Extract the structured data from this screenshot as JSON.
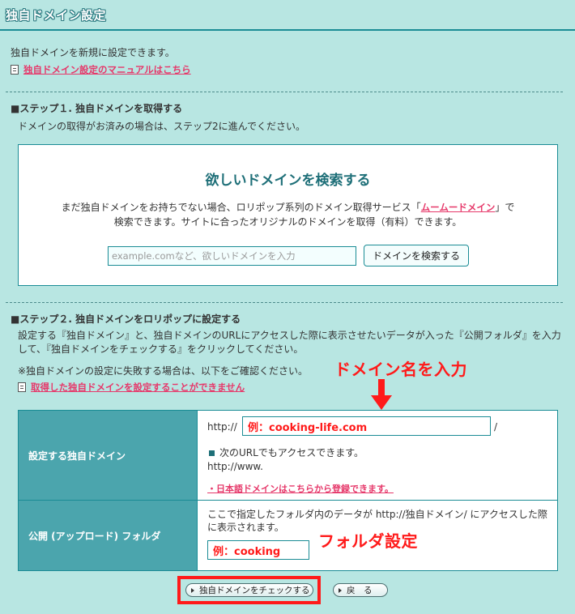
{
  "header": {
    "title": "独自ドメイン設定"
  },
  "intro": {
    "text": "独自ドメインを新規に設定できます。",
    "manual_link": "独自ドメイン設定のマニュアルはこちら"
  },
  "step1": {
    "heading": "■ステップ１. 独自ドメインを取得する",
    "desc": "ドメインの取得がお済みの場合は、ステップ2に進んでください。",
    "search": {
      "title": "欲しいドメインを検索する",
      "desc_line1_pre": "まだ独自ドメインをお持ちでない場合、ロリポップ系列のドメイン取得サービス「",
      "service_link": "ムームードメイン",
      "desc_line1_post": "」で",
      "desc_line2": "検索できます。サイトに合ったオリジナルのドメインを取得（有料）できます。",
      "placeholder": "example.comなど、欲しいドメインを入力",
      "button": "ドメインを検索する"
    }
  },
  "step2": {
    "heading": "■ステップ２. 独自ドメインをロリポップに設定する",
    "desc_line1": "設定する『独自ドメイン』と、独自ドメインのURLにアクセスした際に表示させたいデータが入った『公開フォルダ』を入力",
    "desc_line2": "して、『独自ドメインをチェックする』をクリックしてください。",
    "fail_note": "※独自ドメインの設定に失敗する場合は、以下をご確認ください。",
    "fail_link": "取得した独自ドメインを設定することができません"
  },
  "annotations": {
    "enter_domain": "ドメイン名を入力",
    "folder_setting": "フォルダ設定"
  },
  "table": {
    "domain_label": "設定する独自ドメイン",
    "http_prefix": "http://",
    "domain_value": "例：cooking-life.com",
    "slash": "/",
    "alt_note": "次のURLでもアクセスできます。",
    "alt_url": "http://www.",
    "jp_domain_link": "・日本語ドメインはこちらから登録できます。",
    "folder_label": "公開 (アップロード) フォルダ",
    "folder_desc": "ここで指定したフォルダ内のデータが http://独自ドメイン/ にアクセスした際に表示されます。",
    "folder_value": "例：cooking"
  },
  "actions": {
    "check_button": "独自ドメインをチェックする",
    "back_button": "戻　る"
  },
  "colors": {
    "background": "#b8e6e2",
    "accent": "#1a8c95",
    "label_bg": "#4ba5ad",
    "link": "#e6386a",
    "annotation": "#ff1a1a"
  }
}
